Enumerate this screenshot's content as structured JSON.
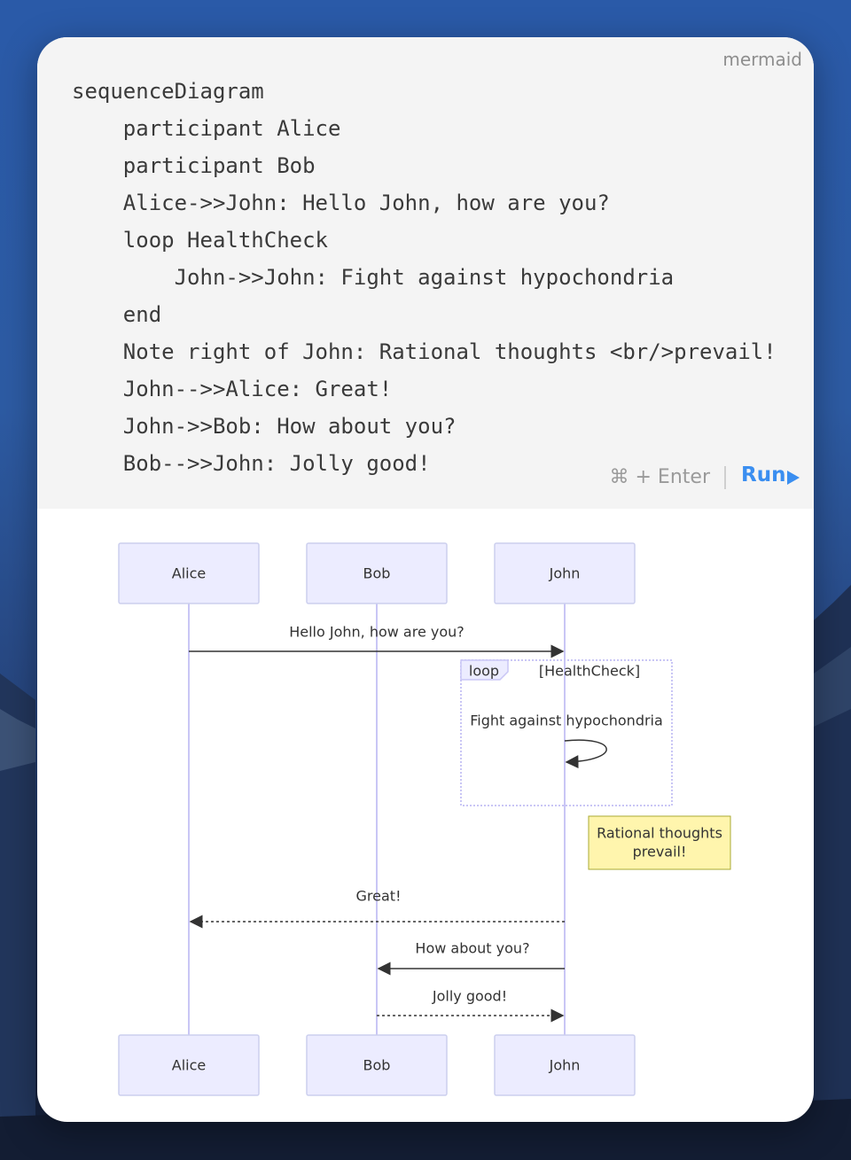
{
  "editor": {
    "language": "mermaid",
    "code_lines": [
      "sequenceDiagram",
      "    participant Alice",
      "    participant Bob",
      "    Alice->>John: Hello John, how are you?",
      "    loop HealthCheck",
      "        John->>John: Fight against hypochondria",
      "    end",
      "    Note right of John: Rational thoughts <br/>prevail!",
      "    John-->>Alice: Great!",
      "    John->>Bob: How about you?",
      "    Bob-->>John: Jolly good!"
    ],
    "shortcut": "⌘ + Enter",
    "run_label": "Run"
  },
  "diagram": {
    "participants": [
      "Alice",
      "Bob",
      "John"
    ],
    "messages": [
      {
        "from": "Alice",
        "to": "John",
        "text": "Hello John, how are you?",
        "style": "solid"
      },
      {
        "from": "John",
        "to": "John",
        "text": "Fight against hypochondria",
        "style": "solid"
      },
      {
        "from": "John",
        "to": "Alice",
        "text": "Great!",
        "style": "dotted"
      },
      {
        "from": "John",
        "to": "Bob",
        "text": "How about you?",
        "style": "solid"
      },
      {
        "from": "Bob",
        "to": "John",
        "text": "Jolly good!",
        "style": "dotted"
      }
    ],
    "loop": {
      "label": "loop",
      "condition": "[HealthCheck]"
    },
    "note": {
      "line1": "Rational thoughts",
      "line2": "prevail!"
    },
    "colors": {
      "actor_fill": "#ececff",
      "actor_stroke": "#cccfee",
      "lifeline": "#c9c6f5",
      "note_fill": "#fff5ad",
      "note_stroke": "#aaaa33",
      "arrow": "#333333",
      "accent": "#3a8ef0"
    }
  }
}
